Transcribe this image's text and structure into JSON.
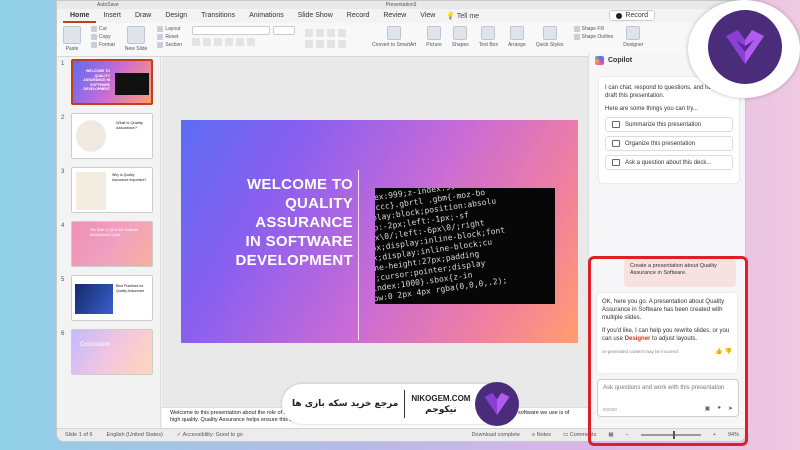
{
  "window": {
    "title": "Presentation3",
    "left_title": "AutoSave"
  },
  "menu": {
    "tabs": [
      "Home",
      "Insert",
      "Draw",
      "Design",
      "Transitions",
      "Animations",
      "Slide Show",
      "Record",
      "Review",
      "View"
    ],
    "tell_me": "Tell me",
    "record_button": "Record",
    "share_partial": "Co"
  },
  "ribbon": {
    "paste": "Paste",
    "cut": "Cut",
    "copy": "Copy",
    "format": "Format",
    "new_slide": "New Slide",
    "layout": "Layout",
    "reset": "Reset",
    "section": "Section",
    "convert": "Convert to SmartArt",
    "picture": "Picture",
    "shapes": "Shapes",
    "text_box": "Text Box",
    "arrange": "Arrange",
    "quick_styles": "Quick Styles",
    "shape_fill": "Shape Fill",
    "shape_outline": "Shape Outline",
    "designer": "Designer"
  },
  "thumbnails": [
    {
      "num": "1",
      "title": "WELCOME TO QUALITY ASSURANCE IN SOFTWARE DEVELOPMENT"
    },
    {
      "num": "2",
      "title": "What is Quality Assurance?"
    },
    {
      "num": "3",
      "title": "Why is Quality Assurance Important?"
    },
    {
      "num": "4",
      "title": "The Role of QA in the Software Development Cycle"
    },
    {
      "num": "5",
      "title": "Best Practices for Quality Assurance"
    },
    {
      "num": "6",
      "title": "Conclusion"
    }
  ],
  "slide": {
    "title_lines": [
      "WELCOME TO",
      "QUALITY",
      "ASSURANCE",
      "IN SOFTWARE",
      "DEVELOPMENT"
    ],
    "code_lines": [
      "-index:999;z-index:99",
      "px #ccc}.gbrtl .gbm{-moz-bo",
      "display:block;position:absolu",
      "-top:-2px;left:-1px;-sf",
      "-4px\\0/;left:-6px\\0/;right",
      "-box;display:inline-block;font",
      "box;display:inline-block;cu",
      "line-height:27px;padding",
      "dy;cursor:pointer;display",
      "-index:1000}.sbox{z-in",
      "dow:0 2px 4px rgba(0,0,0,.2);"
    ]
  },
  "notes": "Welcome to this presentation about the role of quality assurance in software development. In today's world of technology, it's important that the software we use is of high quality. Quality Assurance helps ensure this by checking products against standards.",
  "status": {
    "slide_of": "Slide 1 of 6",
    "language": "English (United States)",
    "accessibility": "Accessibility: Good to go",
    "download": "Download complete",
    "notes": "Notes",
    "comments": "Comments",
    "zoom": "94%"
  },
  "copilot": {
    "header": "Copilot",
    "intro": "I can chat, respond to questions, and help you draft this presentation.",
    "try_label": "Here are some things you can try...",
    "suggestions": [
      "Summarize this presentation",
      "Organize this presentation",
      "Ask a question about this deck..."
    ],
    "user_message": "Create a presentation about Quality Assurance in Software.",
    "response_1": "OK, here you go. A presentation about Quality Assurance in Software has been created with multiple slides.",
    "response_2_a": "If you'd like, I can help you rewrite slides, or you can use ",
    "response_2_designer": "Designer",
    "response_2_b": " to adjust layouts.",
    "ai_note": "AI-generated content may be incorrect",
    "input_placeholder": "Ask questions and work with this presentation",
    "char_count": "0/2000"
  },
  "banner": {
    "persian": "مرجع خرید سکه بازی ها",
    "site": "NIKOGEM.COM",
    "persian_name": "نیکوجم"
  },
  "colors": {
    "accent": "#c43e1c",
    "highlight": "#e01e26",
    "brand_purple": "#4a2c7a"
  }
}
